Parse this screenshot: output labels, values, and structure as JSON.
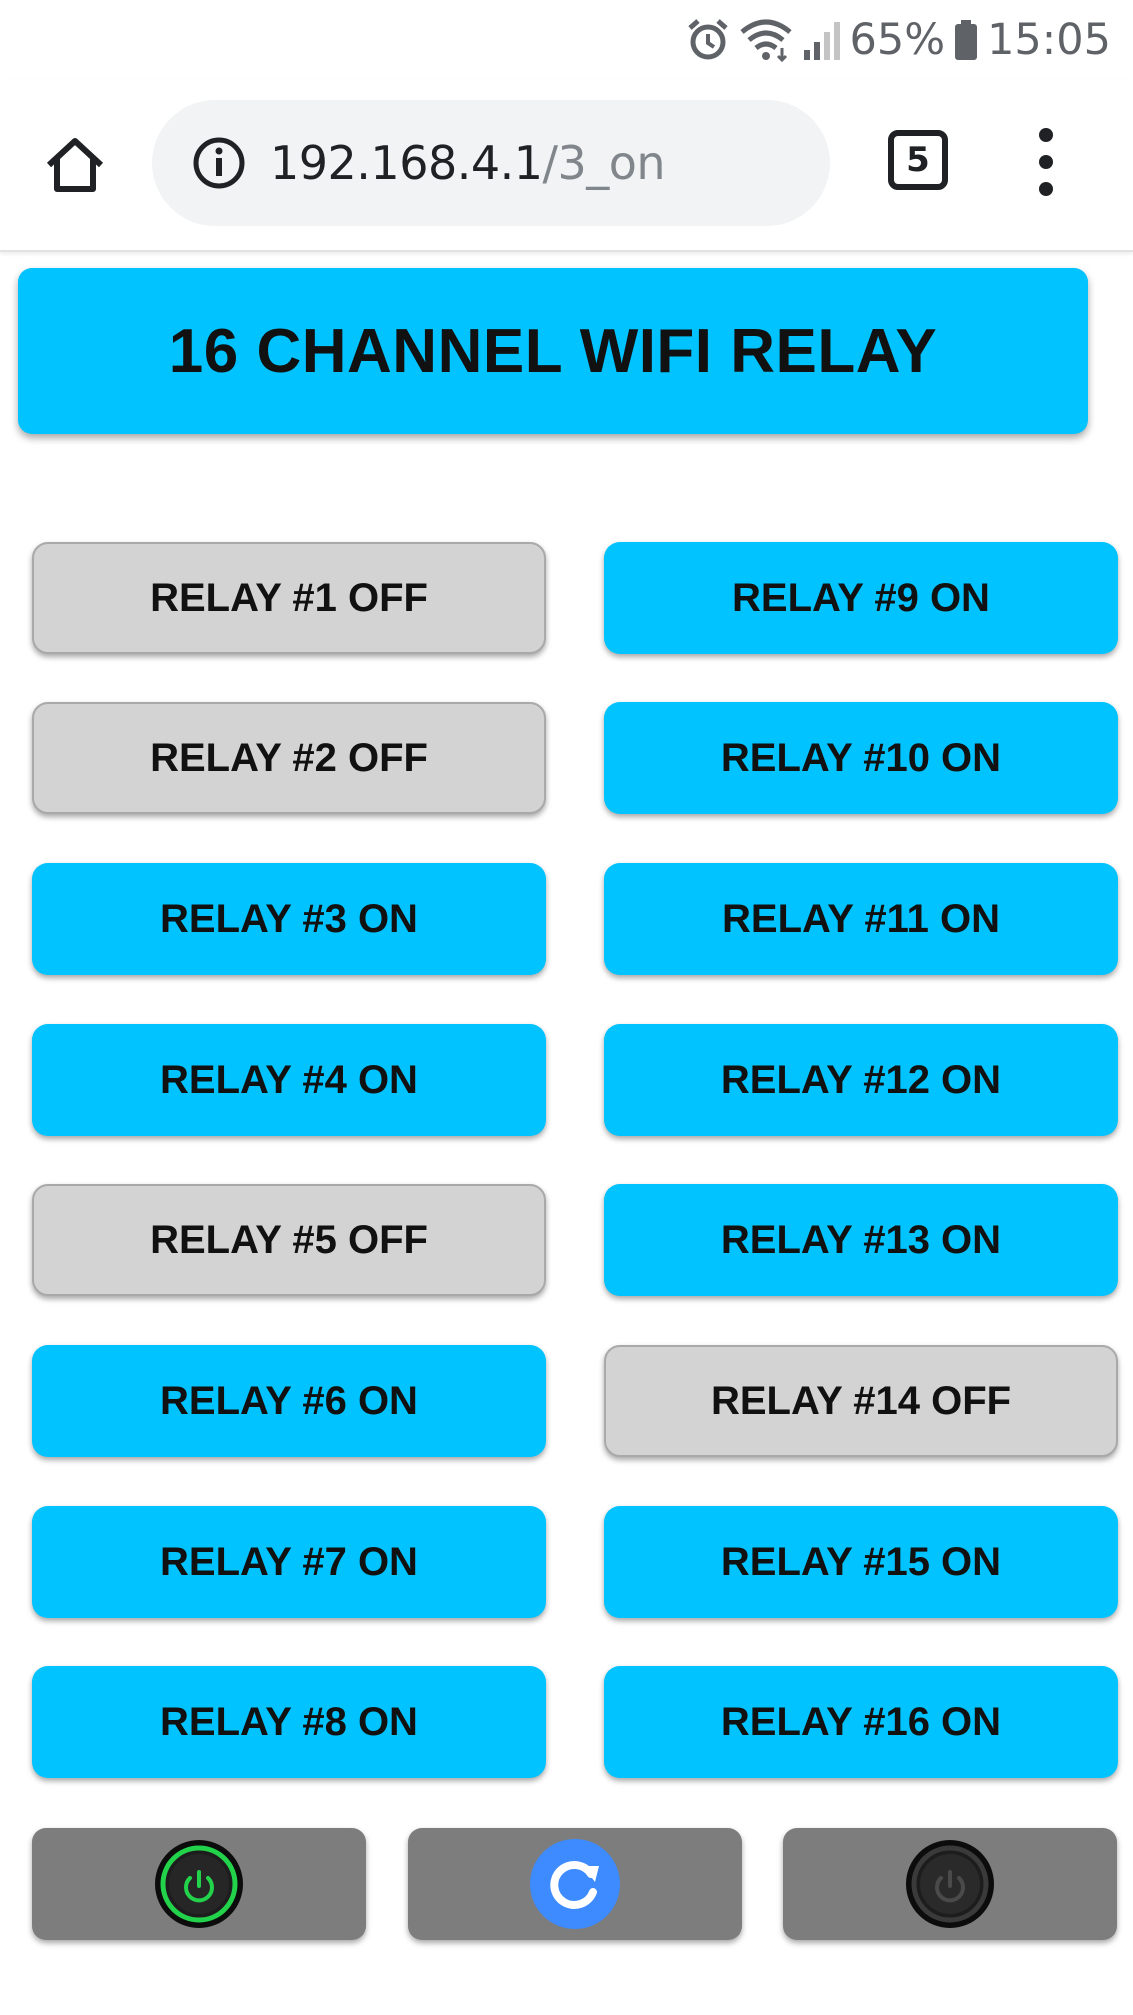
{
  "status_bar": {
    "battery": "65%",
    "time": "15:05"
  },
  "browser": {
    "url_host": "192.168.4.1",
    "url_path": "/3_on",
    "tab_count": "5"
  },
  "page": {
    "title": "16 CHANNEL WIFI RELAY",
    "relays_left": [
      {
        "label": "RELAY #1 OFF",
        "state": "off"
      },
      {
        "label": "RELAY #2 OFF",
        "state": "off"
      },
      {
        "label": "RELAY #3 ON",
        "state": "on"
      },
      {
        "label": "RELAY #4 ON",
        "state": "on"
      },
      {
        "label": "RELAY #5 OFF",
        "state": "off"
      },
      {
        "label": "RELAY #6 ON",
        "state": "on"
      },
      {
        "label": "RELAY #7 ON",
        "state": "on"
      },
      {
        "label": "RELAY #8 ON",
        "state": "on"
      }
    ],
    "relays_right": [
      {
        "label": "RELAY #9 ON",
        "state": "on"
      },
      {
        "label": "RELAY #10 ON",
        "state": "on"
      },
      {
        "label": "RELAY #11 ON",
        "state": "on"
      },
      {
        "label": "RELAY #12 ON",
        "state": "on"
      },
      {
        "label": "RELAY #13 ON",
        "state": "on"
      },
      {
        "label": "RELAY #14 OFF",
        "state": "off"
      },
      {
        "label": "RELAY #15 ON",
        "state": "on"
      },
      {
        "label": "RELAY #16 ON",
        "state": "on"
      }
    ],
    "controls": [
      {
        "name": "all-on",
        "icon": "power-icon-green"
      },
      {
        "name": "refresh",
        "icon": "refresh-icon"
      },
      {
        "name": "all-off",
        "icon": "power-icon-dark"
      }
    ]
  },
  "colors": {
    "relay_on": "#00c3ff",
    "relay_off": "#d3d3d3",
    "control_bg": "#7d7d7d",
    "power_on_green": "#22d24a",
    "refresh_blue": "#3d8bff"
  }
}
